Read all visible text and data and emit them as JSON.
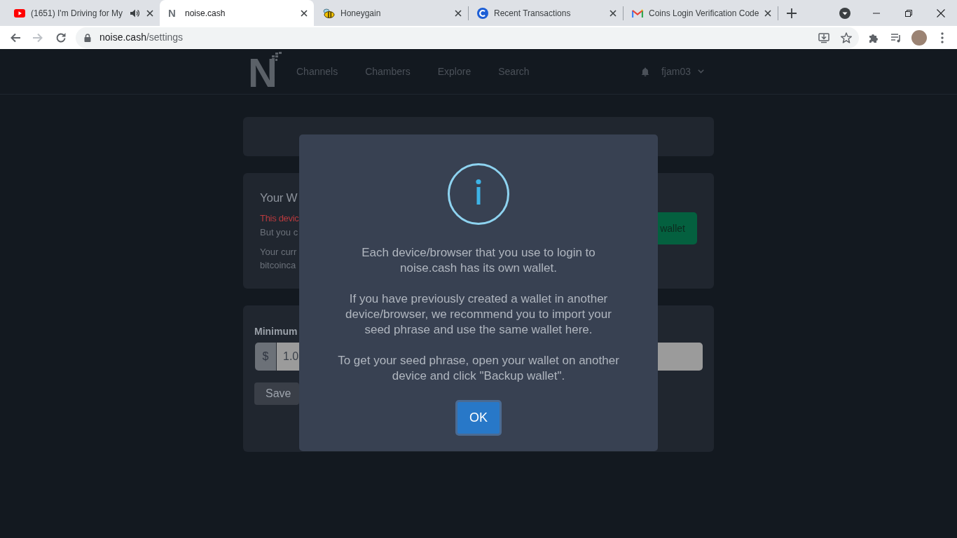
{
  "browser": {
    "tabs": [
      {
        "title": "(1651) I'm Driving for My",
        "kind": "youtube",
        "audio": true,
        "selected": false
      },
      {
        "title": "noise.cash",
        "kind": "letter",
        "favicon_text": "N",
        "audio": false,
        "selected": true
      },
      {
        "title": "Honeygain",
        "kind": "bee",
        "audio": false,
        "selected": false
      },
      {
        "title": "Recent Transactions",
        "kind": "coin",
        "audio": false,
        "selected": false
      },
      {
        "title": "Coins Login Verification Code",
        "kind": "mail",
        "audio": false,
        "selected": false
      }
    ],
    "nav_buttons": [
      {
        "kind": "back",
        "disabled": false
      },
      {
        "kind": "forward",
        "disabled": true
      },
      {
        "kind": "reload",
        "disabled": false
      }
    ],
    "address": {
      "host": "noise.cash",
      "path": "/settings"
    }
  },
  "site": {
    "logo": "N",
    "nav": [
      "Channels",
      "Chambers",
      "Explore",
      "Search"
    ],
    "user": "fjam03"
  },
  "wallet_card": {
    "title": "Your W",
    "warning": "This devic",
    "note": "But you c",
    "info": [
      "Your curr",
      "bitcoinca"
    ],
    "button": "wallet"
  },
  "payment_card": {
    "label": "Minimum",
    "currency": "$",
    "value": "1.0",
    "button": "Save"
  },
  "dialog": {
    "paragraphs": [
      "Each device/browser that you use to login to\nnoise.cash has its own wallet.",
      "If you have previously created a wallet in another\ndevice/browser, we recommend you to import your\nseed phrase and use the same wallet here.",
      "To get your seed phrase, open your wallet on another\ndevice and click \"Backup wallet\"."
    ],
    "button": "OK"
  }
}
